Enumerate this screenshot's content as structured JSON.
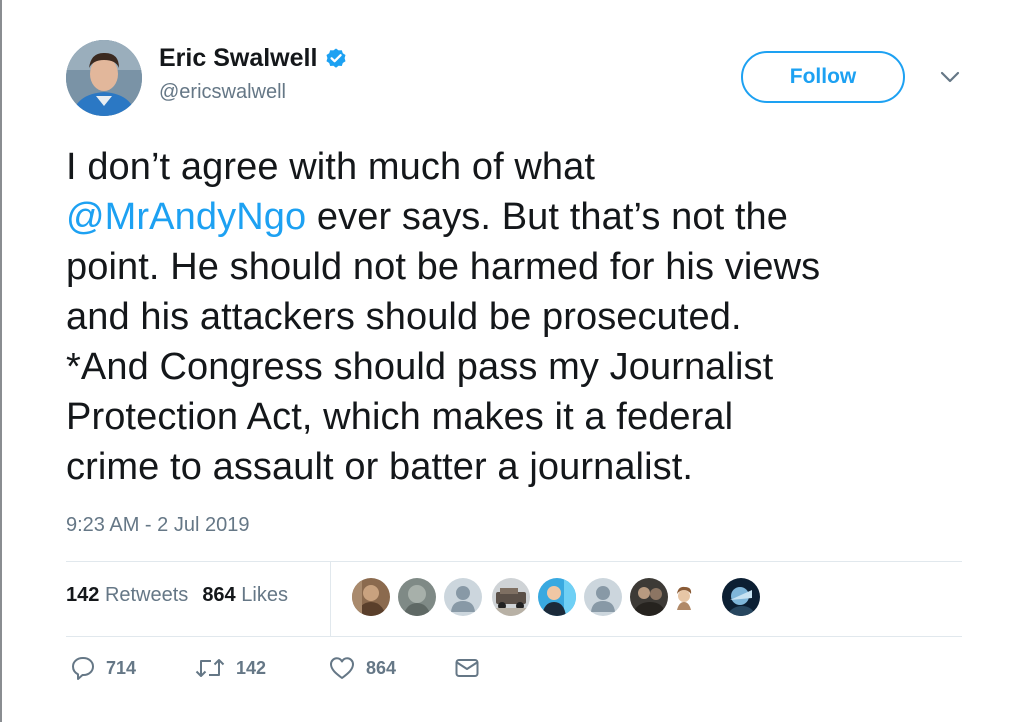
{
  "user": {
    "display_name": "Eric Swalwell",
    "handle": "@ericswalwell"
  },
  "follow_label": "Follow",
  "tweet": {
    "lines": [
      "I don’t agree with much of what",
      "ever says. But that’s not the",
      "point. He should not be harmed for his views",
      "and his attackers should be prosecuted.",
      "*And Congress should pass my Journalist",
      "Protection Act, which makes it a federal",
      "crime to assault or batter a journalist."
    ],
    "mention": "@MrAndyNgo"
  },
  "timestamp": "9:23 AM - 2 Jul 2019",
  "stats": {
    "retweets_count": "142",
    "retweets_label": "Retweets",
    "likes_count": "864",
    "likes_label": "Likes"
  },
  "actions": {
    "reply_count": "714",
    "retweet_count": "142",
    "like_count": "864"
  },
  "colors": {
    "accent": "#1da1f2",
    "secondary_text": "#657786",
    "primary_text": "#14171a",
    "divider": "#e1e8ed"
  },
  "icons": [
    "verified-badge-icon",
    "chevron-down-icon",
    "reply-icon",
    "retweet-icon",
    "like-icon",
    "direct-message-icon"
  ]
}
